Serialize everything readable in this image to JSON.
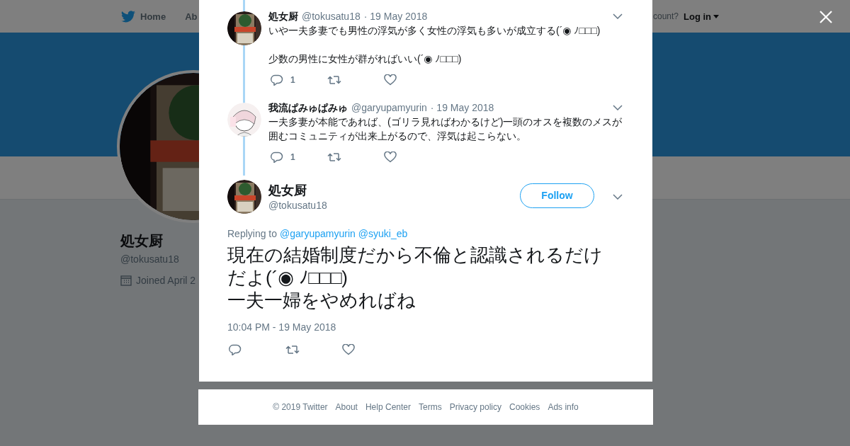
{
  "nav": {
    "items": [
      "Home",
      "Ab"
    ],
    "account_prompt": "count?",
    "login": "Log in"
  },
  "profile": {
    "name": "処女厨",
    "handle": "@tokusatu18",
    "joined": "Joined April 2"
  },
  "thread": [
    {
      "name": "処女厨",
      "handle": "@tokusatu18",
      "date": "· 19 May 2018",
      "lines": [
        "いや一夫多妻でも男性の浮気が多く女性の浮気も多いが成立する(´◉ ﾉ□□□)",
        "少数の男性に女性が群がればいい(´◉ ﾉ□□□)"
      ],
      "replies": "1"
    },
    {
      "name": "我流ぱみゅぱみゅ",
      "handle": "@garyupamyurin",
      "date": "· 19 May 2018",
      "lines": [
        "一夫多妻が本能であれば、(ゴリラ見ればわかるけど)一頭のオスを複数のメスが囲むコミュニティが出来上がるので、浮気は起こらない。"
      ],
      "replies": "1"
    }
  ],
  "main_tweet": {
    "name": "処女厨",
    "handle": "@tokusatu18",
    "follow": "Follow",
    "replying_label": "Replying to",
    "replying_to": [
      "@garyupamyurin",
      "@syuki_eb"
    ],
    "lines": [
      "現在の結婚制度だから不倫と認識されるだけだよ(´◉ ﾉ□□□)",
      "一夫一婦をやめればね"
    ],
    "timestamp": "10:04 PM - 19 May 2018"
  },
  "footer": [
    "© 2019 Twitter",
    "About",
    "Help Center",
    "Terms",
    "Privacy policy",
    "Cookies",
    "Ads info"
  ]
}
